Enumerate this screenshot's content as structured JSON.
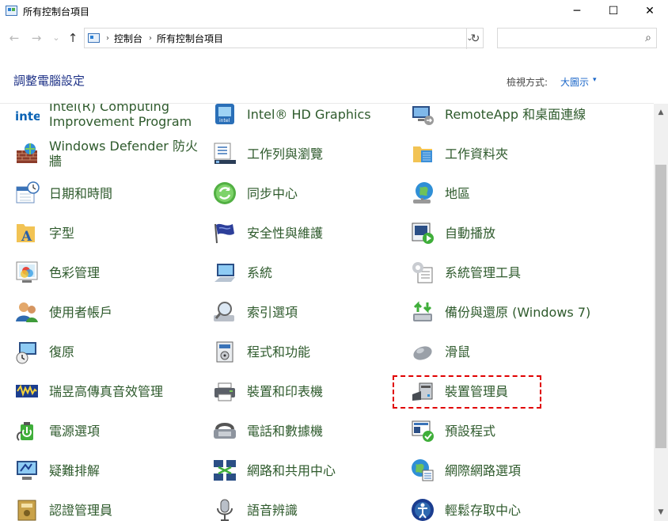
{
  "window": {
    "title": "所有控制台項目",
    "minimize": "─",
    "maximize": "☐",
    "close": "✕"
  },
  "nav": {
    "back": "←",
    "forward": "→",
    "recent": "⌄",
    "up": "↑",
    "breadcrumb": [
      "控制台",
      "所有控制台項目"
    ],
    "separator": "›",
    "dropdown": "⌄",
    "refresh": "↻",
    "search_placeholder": "",
    "search_icon": "⌕"
  },
  "header": {
    "title": "調整電腦設定",
    "view_by_label": "檢視方式:",
    "view_by_value": "大圖示",
    "view_by_caret": "▾"
  },
  "items": [
    {
      "label": "Intel(R) Computing Improvement Program",
      "icon": "intel-icon"
    },
    {
      "label": "Intel® HD Graphics",
      "icon": "intel-hd-graphics-icon"
    },
    {
      "label": "RemoteApp 和桌面連線",
      "icon": "remoteapp-icon"
    },
    {
      "label": "Windows Defender 防火牆",
      "icon": "firewall-icon"
    },
    {
      "label": "工作列與瀏覽",
      "icon": "taskbar-icon"
    },
    {
      "label": "工作資料夾",
      "icon": "work-folders-icon"
    },
    {
      "label": "日期和時間",
      "icon": "date-time-icon"
    },
    {
      "label": "同步中心",
      "icon": "sync-center-icon"
    },
    {
      "label": "地區",
      "icon": "region-icon"
    },
    {
      "label": "字型",
      "icon": "fonts-icon"
    },
    {
      "label": "安全性與維護",
      "icon": "security-flag-icon"
    },
    {
      "label": "自動播放",
      "icon": "autoplay-icon"
    },
    {
      "label": "色彩管理",
      "icon": "color-management-icon"
    },
    {
      "label": "系統",
      "icon": "system-icon"
    },
    {
      "label": "系統管理工具",
      "icon": "admin-tools-icon"
    },
    {
      "label": "使用者帳戶",
      "icon": "user-accounts-icon"
    },
    {
      "label": "索引選項",
      "icon": "indexing-icon"
    },
    {
      "label": "備份與還原 (Windows 7)",
      "icon": "backup-restore-icon"
    },
    {
      "label": "復原",
      "icon": "recovery-icon"
    },
    {
      "label": "程式和功能",
      "icon": "programs-features-icon"
    },
    {
      "label": "滑鼠",
      "icon": "mouse-icon"
    },
    {
      "label": "瑞昱高傳真音效管理",
      "icon": "realtek-audio-icon"
    },
    {
      "label": "裝置和印表機",
      "icon": "devices-printers-icon"
    },
    {
      "label": "裝置管理員",
      "icon": "device-manager-icon"
    },
    {
      "label": "電源選項",
      "icon": "power-options-icon"
    },
    {
      "label": "電話和數據機",
      "icon": "phone-modem-icon"
    },
    {
      "label": "預設程式",
      "icon": "default-programs-icon"
    },
    {
      "label": "疑難排解",
      "icon": "troubleshooting-icon"
    },
    {
      "label": "網路和共用中心",
      "icon": "network-sharing-icon"
    },
    {
      "label": "網際網路選項",
      "icon": "internet-options-icon"
    },
    {
      "label": "認證管理員",
      "icon": "credential-manager-icon"
    },
    {
      "label": "語音辨識",
      "icon": "speech-recognition-icon"
    },
    {
      "label": "輕鬆存取中心",
      "icon": "ease-of-access-icon"
    }
  ],
  "scrollbar": {
    "up": "▲",
    "down": "▼"
  },
  "colors": {
    "item_text": "#2e5a2c",
    "title_text": "#1e3287",
    "link": "#1a66c8",
    "highlight": "#e00000"
  }
}
